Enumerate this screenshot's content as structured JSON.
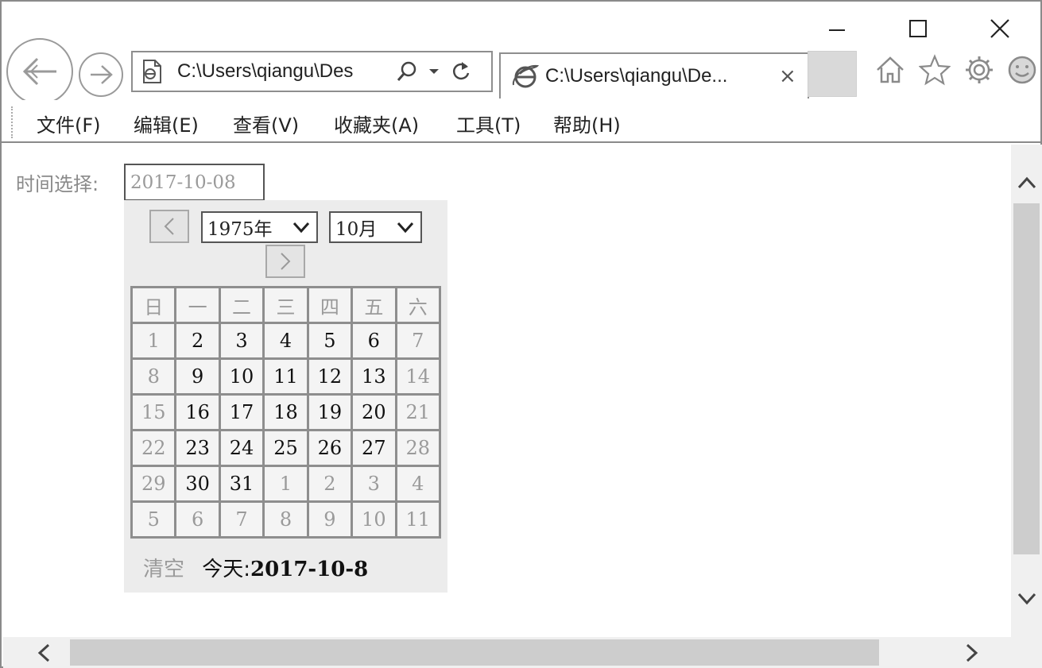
{
  "browser": {
    "address_url": "C:\\Users\\qiangu\\Des",
    "tab_title": "C:\\Users\\qiangu\\De...",
    "tab_close": "×"
  },
  "menu": [
    {
      "label": "文件(F)"
    },
    {
      "label": "编辑(E)"
    },
    {
      "label": "查看(V)"
    },
    {
      "label": "收藏夹(A)"
    },
    {
      "label": "工具(T)"
    },
    {
      "label": "帮助(H)"
    }
  ],
  "form": {
    "label": "时间选择:",
    "value": "2017-10-08"
  },
  "calendar": {
    "year_selected": "1975年",
    "month_selected": "10月",
    "weekdays": [
      "日",
      "一",
      "二",
      "三",
      "四",
      "五",
      "六"
    ],
    "weeks": [
      [
        "1",
        "2",
        "3",
        "4",
        "5",
        "6",
        "7"
      ],
      [
        "8",
        "9",
        "10",
        "11",
        "12",
        "13",
        "14"
      ],
      [
        "15",
        "16",
        "17",
        "18",
        "19",
        "20",
        "21"
      ],
      [
        "22",
        "23",
        "24",
        "25",
        "26",
        "27",
        "28"
      ],
      [
        "29",
        "30",
        "31",
        "1",
        "2",
        "3",
        "4"
      ],
      [
        "5",
        "6",
        "7",
        "8",
        "9",
        "10",
        "11"
      ]
    ],
    "clear_label": "清空",
    "today_label": "今天:",
    "today_date": "2017-10-8"
  },
  "colors": {
    "dim_text": "#9a9a9a",
    "calendar_bg": "#ececec",
    "cell_border": "#8e8e8e",
    "scroll_thumb": "#cdcdcd"
  }
}
